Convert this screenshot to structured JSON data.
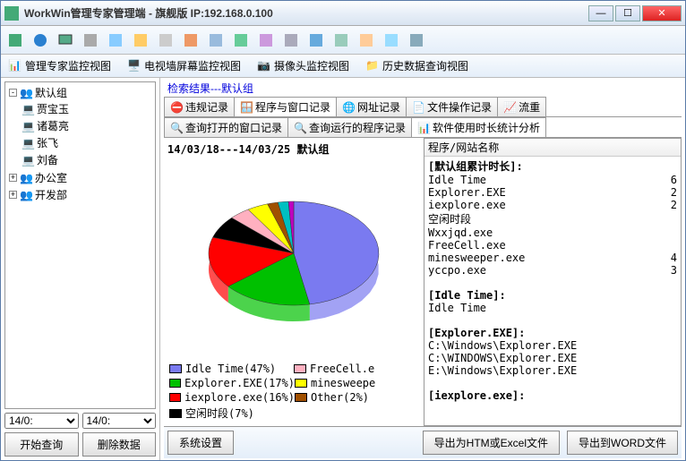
{
  "window": {
    "title": "WorkWin管理专家管理端 - 旗舰版 IP:192.168.0.100"
  },
  "view_tabs": [
    {
      "label": "管理专家监控视图"
    },
    {
      "label": "电视墙屏幕监控视图"
    },
    {
      "label": "摄像头监控视图"
    },
    {
      "label": "历史数据查询视图"
    }
  ],
  "tree": {
    "root": "默认组",
    "members": [
      "贾宝玉",
      "诸葛亮",
      "张飞",
      "刘备"
    ],
    "other_groups": [
      "办公室",
      "开发部"
    ]
  },
  "date": {
    "from": "14/0:",
    "to": "14/0:"
  },
  "sidebar_buttons": {
    "query": "开始查询",
    "delete": "删除数据"
  },
  "search_result": "检索结果---默认组",
  "record_tabs": [
    "违规记录",
    "程序与窗口记录",
    "网址记录",
    "文件操作记录",
    "流重"
  ],
  "sub_tabs": [
    "查询打开的窗口记录",
    "查询运行的程序记录",
    "软件使用时长统计分析"
  ],
  "chart_title": "14/03/18---14/03/25  默认组",
  "list_header": "程序/网站名称",
  "chart_data": {
    "type": "pie",
    "title": "14/03/18---14/03/25  默认组",
    "series": [
      {
        "name": "Idle Time",
        "value": 47,
        "color": "#7a7af0"
      },
      {
        "name": "Explorer.EXE",
        "value": 17,
        "color": "#00c000"
      },
      {
        "name": "iexplore.exe",
        "value": 16,
        "color": "#ff0000"
      },
      {
        "name": "空闲时段",
        "value": 7,
        "color": "#000000"
      },
      {
        "name": "FreeCell.exe",
        "value": 4,
        "color": "#ffb0c0"
      },
      {
        "name": "minesweeper.exe",
        "value": 4,
        "color": "#ffff00"
      },
      {
        "name": "Other",
        "value": 2,
        "color": "#a05000"
      },
      {
        "name": "_unlabeled1",
        "value": 2,
        "color": "#00c0c0"
      },
      {
        "name": "_unlabeled2",
        "value": 1,
        "color": "#c000c0"
      }
    ],
    "legend": [
      {
        "label": "Idle Time(47%)",
        "color": "#7a7af0"
      },
      {
        "label": "Explorer.EXE(17%)",
        "color": "#00c000"
      },
      {
        "label": "iexplore.exe(16%)",
        "color": "#ff0000"
      },
      {
        "label": "空闲时段(7%)",
        "color": "#000000"
      },
      {
        "label": "FreeCell.e",
        "color": "#ffb0c0"
      },
      {
        "label": "minesweepe",
        "color": "#ffff00"
      },
      {
        "label": "Other(2%)",
        "color": "#a05000"
      }
    ]
  },
  "list": {
    "groups": [
      {
        "title": "[默认组累计时长]:",
        "items": [
          {
            "name": "Idle Time",
            "val": "6"
          },
          {
            "name": "Explorer.EXE",
            "val": "2"
          },
          {
            "name": "iexplore.exe",
            "val": "2"
          },
          {
            "name": "空闲时段",
            "val": ""
          },
          {
            "name": "Wxxjqd.exe",
            "val": ""
          },
          {
            "name": "FreeCell.exe",
            "val": ""
          },
          {
            "name": "minesweeper.exe",
            "val": "4"
          },
          {
            "name": "yccpo.exe",
            "val": "3"
          }
        ]
      },
      {
        "title": "[Idle Time]:",
        "items": [
          {
            "name": "Idle Time",
            "val": ""
          }
        ]
      },
      {
        "title": "[Explorer.EXE]:",
        "items": [
          {
            "name": "C:\\Windows\\Explorer.EXE",
            "val": ""
          },
          {
            "name": "C:\\WINDOWS\\Explorer.EXE",
            "val": ""
          },
          {
            "name": "E:\\Windows\\Explorer.EXE",
            "val": ""
          }
        ]
      },
      {
        "title": "[iexplore.exe]:",
        "items": []
      }
    ]
  },
  "bottom_buttons": {
    "settings": "系统设置",
    "export_htm": "导出为HTM或Excel文件",
    "export_word": "导出到WORD文件"
  }
}
